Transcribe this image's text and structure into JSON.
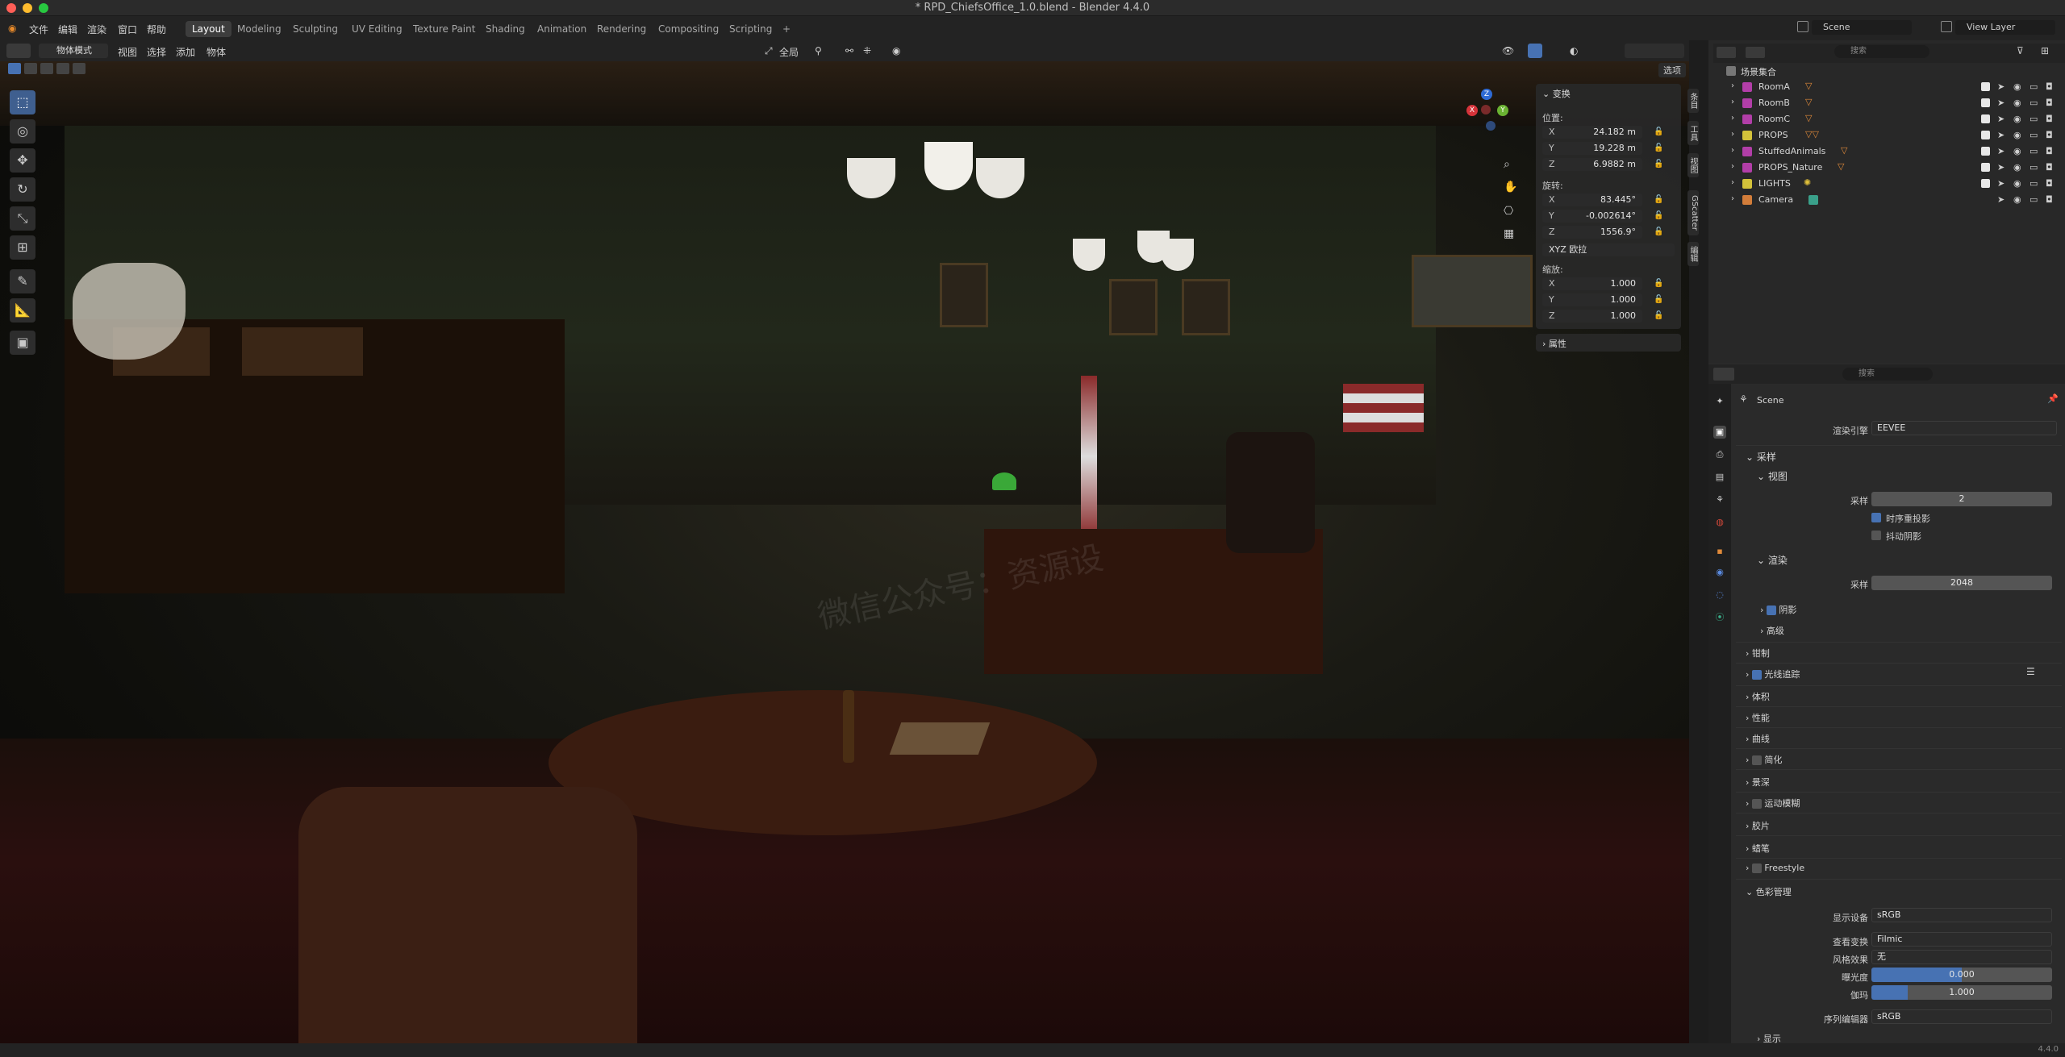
{
  "window": {
    "title": "* RPD_ChiefsOffice_1.0.blend - Blender 4.4.0"
  },
  "menu": {
    "file": "文件",
    "edit": "编辑",
    "render": "渲染",
    "window": "窗口",
    "help": "帮助"
  },
  "workspaces": [
    "Layout",
    "Modeling",
    "Sculpting",
    "UV Editing",
    "Texture Paint",
    "Shading",
    "Animation",
    "Rendering",
    "Compositing",
    "Scripting"
  ],
  "workspace_add": "+",
  "viewport_header": {
    "mode": "物体模式",
    "view": "视图",
    "select": "选择",
    "add": "添加",
    "object": "物体",
    "transform_orientation": "全局",
    "options": "选项"
  },
  "top_right": {
    "scene_label": "Scene",
    "view_layer": "View Layer"
  },
  "npanel": {
    "title": "变换",
    "location_label": "位置:",
    "location": [
      {
        "axis": "X",
        "value": "24.182 m"
      },
      {
        "axis": "Y",
        "value": "19.228 m"
      },
      {
        "axis": "Z",
        "value": "6.9882 m"
      }
    ],
    "rotation_label": "旋转:",
    "rotation": [
      {
        "axis": "X",
        "value": "83.445°"
      },
      {
        "axis": "Y",
        "value": "-0.002614°"
      },
      {
        "axis": "Z",
        "value": "1556.9°"
      }
    ],
    "rotation_mode": "XYZ 欧拉",
    "scale_label": "缩放:",
    "scale": [
      {
        "axis": "X",
        "value": "1.000"
      },
      {
        "axis": "Y",
        "value": "1.000"
      },
      {
        "axis": "Z",
        "value": "1.000"
      }
    ],
    "properties_label": "属性"
  },
  "side_tabs": [
    "条目",
    "工具",
    "视图",
    "GScatter",
    "编辑"
  ],
  "gizmo": {
    "x": "X",
    "y": "Y",
    "z": "Z"
  },
  "outliner": {
    "search_placeholder": "搜索",
    "root": "场景集合",
    "items": [
      {
        "name": "RoomA",
        "color": "#b23ea8"
      },
      {
        "name": "RoomB",
        "color": "#b23ea8"
      },
      {
        "name": "RoomC",
        "color": "#b23ea8"
      },
      {
        "name": "PROPS",
        "color": "#d3c23a"
      },
      {
        "name": "StuffedAnimals",
        "color": "#b23ea8"
      },
      {
        "name": "PROPS_Nature",
        "color": "#b23ea8"
      },
      {
        "name": "LIGHTS",
        "color": "#d3c23a"
      },
      {
        "name": "Camera",
        "color": "#d27d3a"
      }
    ]
  },
  "properties": {
    "search_placeholder": "搜索",
    "scene": "Scene",
    "render_engine_label": "渲染引擎",
    "render_engine": "EEVEE",
    "sampling": "采样",
    "viewport": "视图",
    "vp_samples_label": "采样",
    "vp_samples": "2",
    "temporal_reprojection": "时序重投影",
    "jitter_shadows": "抖动阴影",
    "render": "渲染",
    "render_samples_label": "采样",
    "render_samples": "2048",
    "shadows": "阴影",
    "advanced": "高级",
    "clamping": "钳制",
    "raytracing": "光线追踪",
    "volumes": "体积",
    "performance": "性能",
    "curves": "曲线",
    "simplify": "简化",
    "dof": "景深",
    "motion_blur": "运动模糊",
    "film": "胶片",
    "grease_pencil": "蜡笔",
    "freestyle": "Freestyle",
    "color_management": "色彩管理",
    "display_device_label": "显示设备",
    "display_device": "sRGB",
    "view_transform_label": "查看变换",
    "view_transform": "Filmic",
    "look_label": "风格效果",
    "look": "无",
    "exposure_label": "曝光度",
    "exposure": "0.000",
    "gamma_label": "伽玛",
    "gamma": "1.000",
    "sequencer_label": "序列编辑器",
    "sequencer": "sRGB",
    "display": "显示"
  },
  "status": {
    "version": "4.4.0"
  },
  "colors": {
    "accent": "#4772b3",
    "active_tool": "#3f5f8f"
  }
}
